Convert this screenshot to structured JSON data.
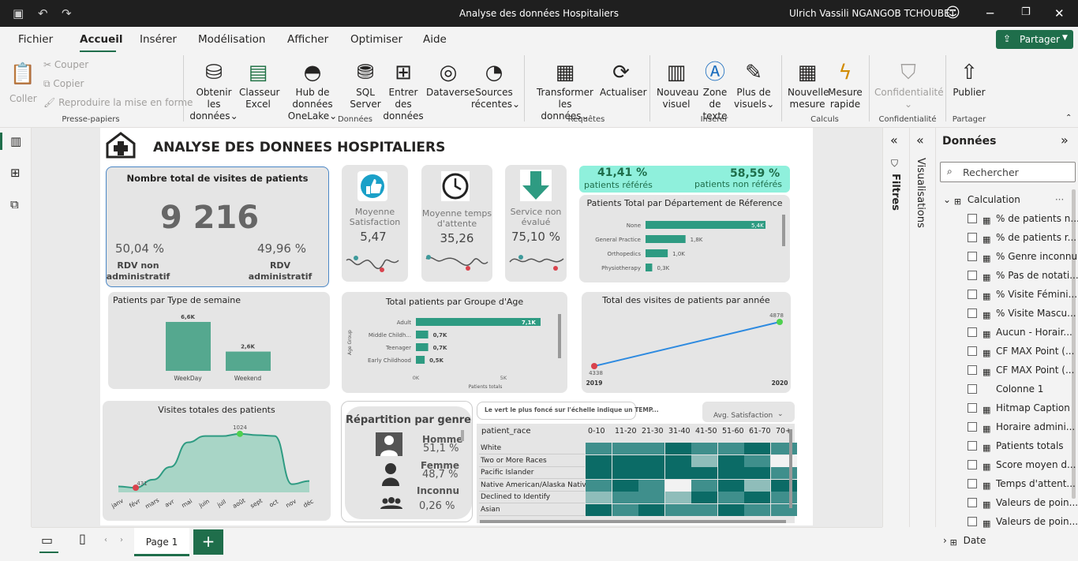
{
  "app": {
    "title": "Analyse des données Hospitaliers",
    "user": "Ulrich Vassili NGANGOB TCHOUBET"
  },
  "menu": [
    "Fichier",
    "Accueil",
    "Insérer",
    "Modélisation",
    "Afficher",
    "Optimiser",
    "Aide"
  ],
  "share_label": "Partager",
  "ribbon": {
    "clipboard": {
      "paste": "Coller",
      "cut": "Couper",
      "copy": "Copier",
      "format": "Reproduire la mise en forme",
      "group": "Presse-papiers"
    },
    "data": {
      "get_l1": "Obtenir les",
      "get_l2": "données",
      "excel_l1": "Classeur",
      "excel_l2": "Excel",
      "hub_l1": "Hub de données",
      "hub_l2": "OneLake",
      "sql_l1": "SQL",
      "sql_l2": "Server",
      "enter_l1": "Entrer des",
      "enter_l2": "données",
      "dataverse": "Dataverse",
      "recent_l1": "Sources",
      "recent_l2": "récentes",
      "group": "Données"
    },
    "queries": {
      "transform_l1": "Transformer les",
      "transform_l2": "données",
      "refresh": "Actualiser",
      "group": "Requêtes"
    },
    "insert": {
      "visual_l1": "Nouveau",
      "visual_l2": "visuel",
      "text_l1": "Zone de",
      "text_l2": "texte",
      "more_l1": "Plus de",
      "more_l2": "visuels",
      "group": "Insérer"
    },
    "calc": {
      "measure_l1": "Nouvelle",
      "measure_l2": "mesure",
      "quick_l1": "Mesure",
      "quick_l2": "rapide",
      "group": "Calculs"
    },
    "conf": {
      "label": "Confidentialité",
      "group": "Confidentialité"
    },
    "share": {
      "publish": "Publier",
      "group": "Partager"
    }
  },
  "report": {
    "title": "ANALYSE DES DONNEES HOSPITALIERS",
    "total_visits": {
      "title": "Nombre total de visites de patients",
      "value": "9 216",
      "pct_left": "50,04 %",
      "lbl_left_1": "RDV non",
      "lbl_left_2": "administratif",
      "pct_right": "49,96 %",
      "lbl_right_1": "RDV",
      "lbl_right_2": "administratif"
    },
    "kpi1": {
      "l1": "Moyenne",
      "l2": "Satisfaction",
      "value": "5,47"
    },
    "kpi2": {
      "l1": "Moyenne temps",
      "l2": "d'attente",
      "value": "35,26"
    },
    "kpi3": {
      "l1": "Service non",
      "l2": "évalué",
      "value": "75,10 %"
    },
    "referral": {
      "pct1": "41,41 %",
      "lbl1": "patients référés",
      "pct2": "58,59 %",
      "lbl2": "patients non référés"
    },
    "dept": {
      "title": "Patients Total par Département de Réference",
      "items": [
        {
          "name": "None",
          "label": "5,4K"
        },
        {
          "name": "General Practice",
          "label": "1,8K"
        },
        {
          "name": "Orthopedics",
          "label": "1,0K"
        },
        {
          "name": "Physiotherapy",
          "label": "0,3K"
        }
      ]
    },
    "week": {
      "title": "Patients par Type de semaine",
      "items": [
        {
          "name": "WeekDay",
          "label": "6,6K"
        },
        {
          "name": "Weekend",
          "label": "2,6K"
        }
      ]
    },
    "age": {
      "title": "Total patients par Groupe d'Age",
      "yaxis": "Age Group",
      "xaxis": "Patients totals",
      "ticks": [
        "0K",
        "5K"
      ],
      "items": [
        {
          "name": "Adult",
          "label": "7,1K"
        },
        {
          "name": "Middle Childh...",
          "label": "0,7K"
        },
        {
          "name": "Teenager",
          "label": "0,7K"
        },
        {
          "name": "Early Childhood",
          "label": "0,5K"
        }
      ]
    },
    "yearly": {
      "title": "Total des visites de patients par année",
      "x": [
        "2019",
        "2020"
      ],
      "v": [
        "4338",
        "4878"
      ]
    },
    "monthly": {
      "title": "Visites totales des patients",
      "min_label": "431",
      "max_label": "1024",
      "months": [
        "janv",
        "févr",
        "mars",
        "avr",
        "mai",
        "juin",
        "juil",
        "août",
        "sept",
        "oct",
        "nov",
        "déc"
      ]
    },
    "gender": {
      "title": "Répartition par genre",
      "male_lbl": "Homme",
      "male_pct": "51,1 %",
      "female_lbl": "Femme",
      "female_pct": "48,7 %",
      "unknown_lbl": "Inconnu",
      "unknown_pct": "0,26 %"
    },
    "heat": {
      "tooltip": "Le vert le plus foncé sur l'échelle indique un TEMP...",
      "dropdown": "Avg. Satisfaction",
      "header": "patient_race",
      "cols": [
        "0-10",
        "11-20",
        "21-30",
        "31-40",
        "41-50",
        "51-60",
        "61-70",
        "70+"
      ],
      "rows": [
        "White",
        "Two or More Races",
        "Pacific Islander",
        "Native American/Alaska Native",
        "Declined to Identify",
        "Asian"
      ]
    }
  },
  "pages": {
    "tab": "Page 1"
  },
  "panes": {
    "filters": "Filtres",
    "visuals": "Visualisations",
    "data": "Données",
    "search": "Rechercher",
    "table": "Calculation",
    "fields": [
      "% de patients n...",
      "% de patients r...",
      "% Genre inconnu",
      "% Pas de notati...",
      "% Visite Fémini...",
      "% Visite Mascu...",
      "Aucun - Horair...",
      "CF MAX Point (...",
      "CF MAX Point (...",
      "Colonne 1",
      "Hitmap Caption",
      "Horaire admini...",
      "Patients totals",
      "Score moyen d...",
      "Temps d'attent...",
      "Valeurs de poin...",
      "Valeurs de poin..."
    ],
    "date_table": "Date"
  }
}
